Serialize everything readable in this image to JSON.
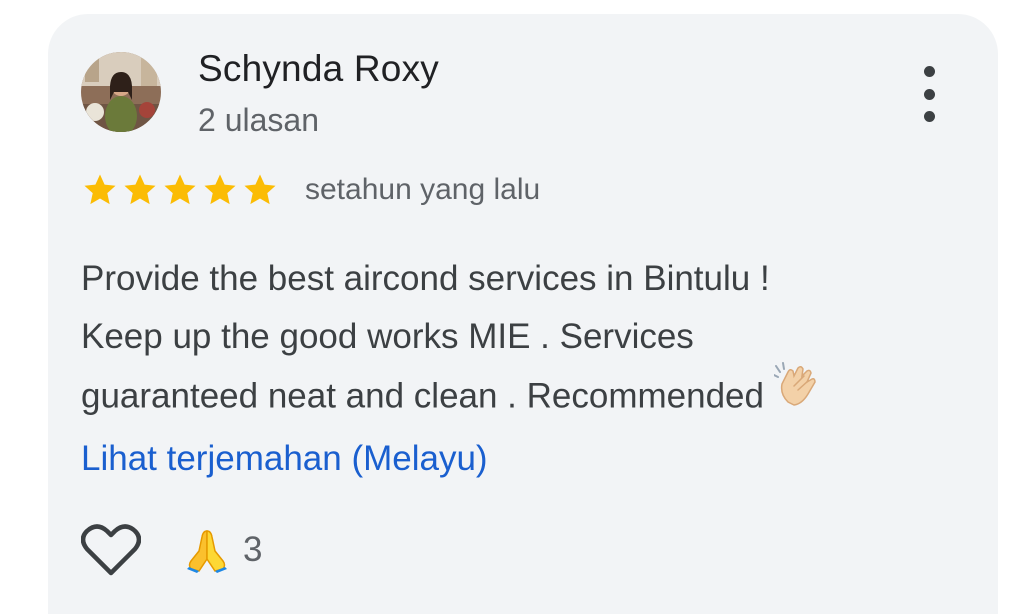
{
  "review": {
    "author": {
      "name": "Schynda Roxy",
      "review_count": "2 ulasan"
    },
    "rating": {
      "stars": 5,
      "max_stars": 5,
      "time": "setahun yang lalu"
    },
    "text_lines": [
      "Provide the best aircond services in Bintulu !",
      "Keep up the good works MIE . Services",
      "guaranteed neat and clean . Recommended"
    ],
    "translate_link": "Lihat terjemahan (Melayu)",
    "reactions": {
      "count": "3"
    }
  },
  "icons": {
    "more": "more-vert-icon",
    "star": "star-icon",
    "like": "heart-outline-icon",
    "reaction": "folded-hands-icon",
    "emoji_in_text": "clapping-hands-icon"
  },
  "colors": {
    "card_background": "#f2f4f6",
    "star": "#fbbc04",
    "link": "#1a5fcf",
    "primary_text": "#202124",
    "secondary_text": "#5f6368"
  }
}
